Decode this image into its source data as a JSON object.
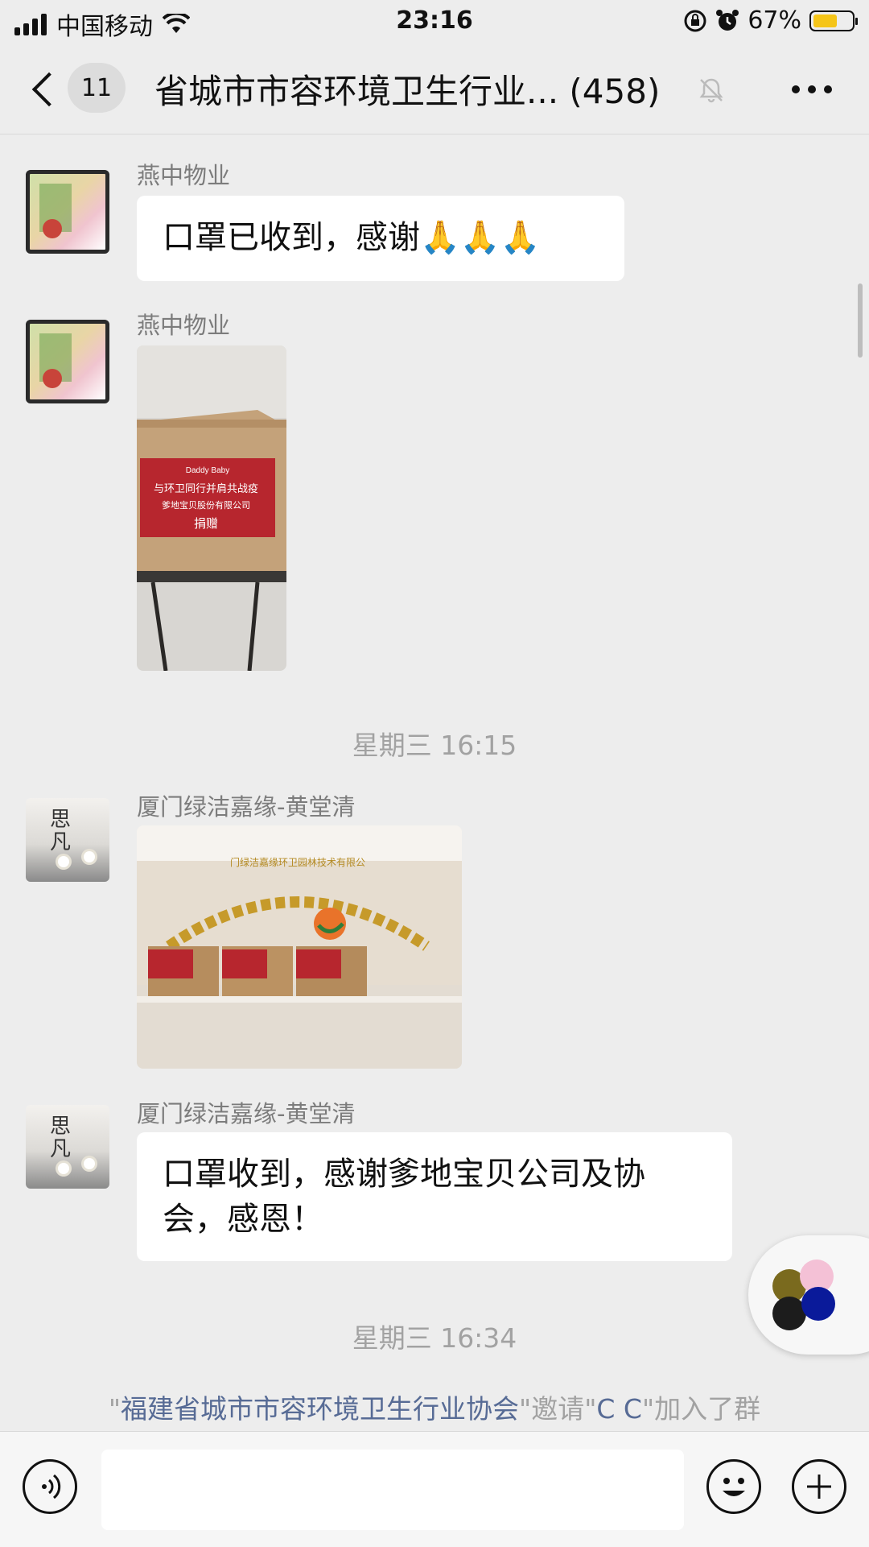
{
  "status_bar": {
    "carrier": "中国移动",
    "time": "23:16",
    "battery_percent": "67%",
    "battery_level": 0.67
  },
  "nav": {
    "unread_count": "11",
    "title": "省城市市容环境卫生行业... (458)"
  },
  "messages": [
    {
      "sender": "燕中物业",
      "type": "text",
      "text": "口罩已收到，感谢🙏🙏🙏"
    },
    {
      "sender": "燕中物业",
      "type": "image",
      "image_text": [
        "Daddy Baby",
        "与环卫同行并肩共战疫",
        "爹地宝贝股份有限公司",
        "捐赠"
      ]
    },
    {
      "type": "timestamp",
      "text": "星期三 16:15"
    },
    {
      "sender": "厦门绿洁嘉缘-黄堂清",
      "type": "image",
      "image_text": [
        "门绿洁嘉缘环卫园林技术有限公"
      ]
    },
    {
      "sender": "厦门绿洁嘉缘-黄堂清",
      "type": "text",
      "text_line1": "口罩收到，感谢爹地宝贝公司及协",
      "text_line2": "会，感恩！"
    },
    {
      "type": "timestamp",
      "text": "星期三 16:34"
    }
  ],
  "system_message": {
    "q1": "\"",
    "inviter": "福建省城市市容环境卫生行业协会",
    "mid": "\"邀请\"",
    "invitee": "C C",
    "end": "\"加入了群"
  },
  "avatar_text": {
    "char1": "思",
    "char2": "凡"
  },
  "icons": [
    "signal-icon",
    "wifi-icon",
    "orientation-lock-icon",
    "alarm-icon",
    "battery-icon",
    "back-icon",
    "mute-bell-icon",
    "more-icon",
    "voice-icon",
    "emoji-icon",
    "plus-icon",
    "mini-program-float-icon"
  ],
  "colors": {
    "background": "#EDEDED",
    "bubble": "#FFFFFF",
    "link": "#576B95",
    "battery": "#F5C518"
  }
}
